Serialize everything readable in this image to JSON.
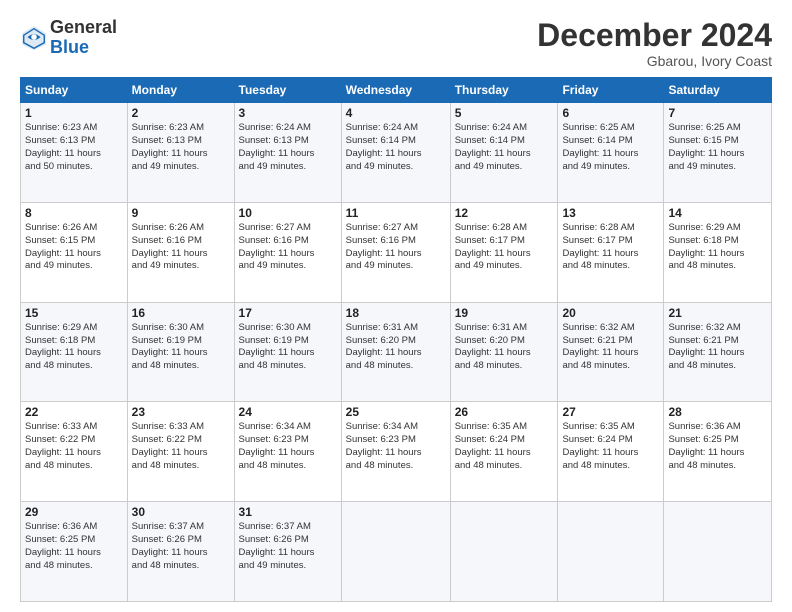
{
  "logo": {
    "general": "General",
    "blue": "Blue"
  },
  "header": {
    "month": "December 2024",
    "location": "Gbarou, Ivory Coast"
  },
  "weekdays": [
    "Sunday",
    "Monday",
    "Tuesday",
    "Wednesday",
    "Thursday",
    "Friday",
    "Saturday"
  ],
  "weeks": [
    [
      {
        "day": "1",
        "info": "Sunrise: 6:23 AM\nSunset: 6:13 PM\nDaylight: 11 hours\nand 50 minutes."
      },
      {
        "day": "2",
        "info": "Sunrise: 6:23 AM\nSunset: 6:13 PM\nDaylight: 11 hours\nand 49 minutes."
      },
      {
        "day": "3",
        "info": "Sunrise: 6:24 AM\nSunset: 6:13 PM\nDaylight: 11 hours\nand 49 minutes."
      },
      {
        "day": "4",
        "info": "Sunrise: 6:24 AM\nSunset: 6:14 PM\nDaylight: 11 hours\nand 49 minutes."
      },
      {
        "day": "5",
        "info": "Sunrise: 6:24 AM\nSunset: 6:14 PM\nDaylight: 11 hours\nand 49 minutes."
      },
      {
        "day": "6",
        "info": "Sunrise: 6:25 AM\nSunset: 6:14 PM\nDaylight: 11 hours\nand 49 minutes."
      },
      {
        "day": "7",
        "info": "Sunrise: 6:25 AM\nSunset: 6:15 PM\nDaylight: 11 hours\nand 49 minutes."
      }
    ],
    [
      {
        "day": "8",
        "info": "Sunrise: 6:26 AM\nSunset: 6:15 PM\nDaylight: 11 hours\nand 49 minutes."
      },
      {
        "day": "9",
        "info": "Sunrise: 6:26 AM\nSunset: 6:16 PM\nDaylight: 11 hours\nand 49 minutes."
      },
      {
        "day": "10",
        "info": "Sunrise: 6:27 AM\nSunset: 6:16 PM\nDaylight: 11 hours\nand 49 minutes."
      },
      {
        "day": "11",
        "info": "Sunrise: 6:27 AM\nSunset: 6:16 PM\nDaylight: 11 hours\nand 49 minutes."
      },
      {
        "day": "12",
        "info": "Sunrise: 6:28 AM\nSunset: 6:17 PM\nDaylight: 11 hours\nand 49 minutes."
      },
      {
        "day": "13",
        "info": "Sunrise: 6:28 AM\nSunset: 6:17 PM\nDaylight: 11 hours\nand 48 minutes."
      },
      {
        "day": "14",
        "info": "Sunrise: 6:29 AM\nSunset: 6:18 PM\nDaylight: 11 hours\nand 48 minutes."
      }
    ],
    [
      {
        "day": "15",
        "info": "Sunrise: 6:29 AM\nSunset: 6:18 PM\nDaylight: 11 hours\nand 48 minutes."
      },
      {
        "day": "16",
        "info": "Sunrise: 6:30 AM\nSunset: 6:19 PM\nDaylight: 11 hours\nand 48 minutes."
      },
      {
        "day": "17",
        "info": "Sunrise: 6:30 AM\nSunset: 6:19 PM\nDaylight: 11 hours\nand 48 minutes."
      },
      {
        "day": "18",
        "info": "Sunrise: 6:31 AM\nSunset: 6:20 PM\nDaylight: 11 hours\nand 48 minutes."
      },
      {
        "day": "19",
        "info": "Sunrise: 6:31 AM\nSunset: 6:20 PM\nDaylight: 11 hours\nand 48 minutes."
      },
      {
        "day": "20",
        "info": "Sunrise: 6:32 AM\nSunset: 6:21 PM\nDaylight: 11 hours\nand 48 minutes."
      },
      {
        "day": "21",
        "info": "Sunrise: 6:32 AM\nSunset: 6:21 PM\nDaylight: 11 hours\nand 48 minutes."
      }
    ],
    [
      {
        "day": "22",
        "info": "Sunrise: 6:33 AM\nSunset: 6:22 PM\nDaylight: 11 hours\nand 48 minutes."
      },
      {
        "day": "23",
        "info": "Sunrise: 6:33 AM\nSunset: 6:22 PM\nDaylight: 11 hours\nand 48 minutes."
      },
      {
        "day": "24",
        "info": "Sunrise: 6:34 AM\nSunset: 6:23 PM\nDaylight: 11 hours\nand 48 minutes."
      },
      {
        "day": "25",
        "info": "Sunrise: 6:34 AM\nSunset: 6:23 PM\nDaylight: 11 hours\nand 48 minutes."
      },
      {
        "day": "26",
        "info": "Sunrise: 6:35 AM\nSunset: 6:24 PM\nDaylight: 11 hours\nand 48 minutes."
      },
      {
        "day": "27",
        "info": "Sunrise: 6:35 AM\nSunset: 6:24 PM\nDaylight: 11 hours\nand 48 minutes."
      },
      {
        "day": "28",
        "info": "Sunrise: 6:36 AM\nSunset: 6:25 PM\nDaylight: 11 hours\nand 48 minutes."
      }
    ],
    [
      {
        "day": "29",
        "info": "Sunrise: 6:36 AM\nSunset: 6:25 PM\nDaylight: 11 hours\nand 48 minutes."
      },
      {
        "day": "30",
        "info": "Sunrise: 6:37 AM\nSunset: 6:26 PM\nDaylight: 11 hours\nand 48 minutes."
      },
      {
        "day": "31",
        "info": "Sunrise: 6:37 AM\nSunset: 6:26 PM\nDaylight: 11 hours\nand 49 minutes."
      },
      {
        "day": "",
        "info": ""
      },
      {
        "day": "",
        "info": ""
      },
      {
        "day": "",
        "info": ""
      },
      {
        "day": "",
        "info": ""
      }
    ]
  ]
}
